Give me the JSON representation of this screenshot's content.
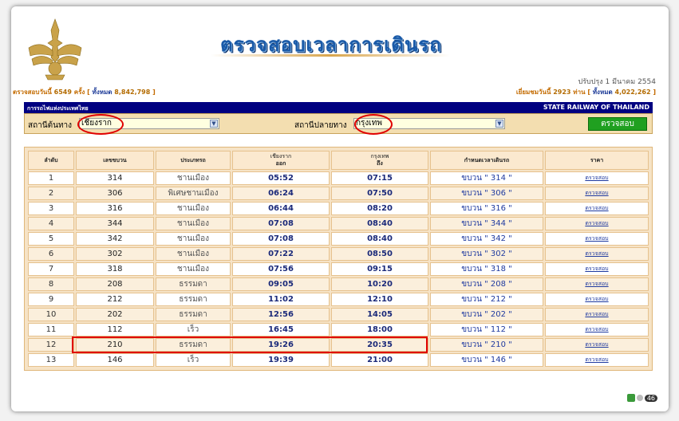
{
  "header": {
    "title": "ตรวจสอบเวลาการเดินรถ",
    "updated": "ปรับปรุง 1 มีนาคม 2554",
    "checks_prefix": "ตรวจสอบวันนี้",
    "checks_today": "6549",
    "checks_unit": "ครั้ง",
    "checks_total_label": "ทั้งหมด",
    "checks_total": "8,842,798",
    "visitors_prefix": "เยี่ยมชมวันนี้",
    "visitors_today": "2923",
    "visitors_unit": "ท่าน",
    "visitors_total_label": "ทั้งหมด",
    "visitors_total": "4,022,262"
  },
  "bar": {
    "org_th": "การรถไฟแห่งประเทศไทย",
    "org_en": "STATE RAILWAY OF THAILAND"
  },
  "search": {
    "origin_label": "สถานีต้นทาง",
    "origin_value": "เชียงราก",
    "destination_label": "สถานีปลายทาง",
    "destination_value": "กรุงเทพ",
    "submit_label": "ตรวจสอบ"
  },
  "table": {
    "headers": {
      "seq": "ลำดับ",
      "train_no": "เลขขบวน",
      "type": "ประเภทรถ",
      "origin_station": "เชียงราก",
      "depart": "ออก",
      "dest_station": "กรุงเทพ",
      "arrive": "ถึง",
      "schedule": "กำหนดเวลาเดินรถ",
      "price": "ราคา"
    },
    "rows": [
      {
        "seq": "1",
        "train_no": "314",
        "type": "ชานเมือง",
        "depart": "05:52",
        "arrive": "07:15",
        "schedule": "ขบวน \" 314 \"",
        "price": "ตรวจสอบ"
      },
      {
        "seq": "2",
        "train_no": "306",
        "type": "พิเศษชานเมือง",
        "depart": "06:24",
        "arrive": "07:50",
        "schedule": "ขบวน \" 306 \"",
        "price": "ตรวจสอบ"
      },
      {
        "seq": "3",
        "train_no": "316",
        "type": "ชานเมือง",
        "depart": "06:44",
        "arrive": "08:20",
        "schedule": "ขบวน \" 316 \"",
        "price": "ตรวจสอบ"
      },
      {
        "seq": "4",
        "train_no": "344",
        "type": "ชานเมือง",
        "depart": "07:08",
        "arrive": "08:40",
        "schedule": "ขบวน \" 344 \"",
        "price": "ตรวจสอบ"
      },
      {
        "seq": "5",
        "train_no": "342",
        "type": "ชานเมือง",
        "depart": "07:08",
        "arrive": "08:40",
        "schedule": "ขบวน \" 342 \"",
        "price": "ตรวจสอบ"
      },
      {
        "seq": "6",
        "train_no": "302",
        "type": "ชานเมือง",
        "depart": "07:22",
        "arrive": "08:50",
        "schedule": "ขบวน \" 302 \"",
        "price": "ตรวจสอบ"
      },
      {
        "seq": "7",
        "train_no": "318",
        "type": "ชานเมือง",
        "depart": "07:56",
        "arrive": "09:15",
        "schedule": "ขบวน \" 318 \"",
        "price": "ตรวจสอบ"
      },
      {
        "seq": "8",
        "train_no": "208",
        "type": "ธรรมดา",
        "depart": "09:05",
        "arrive": "10:20",
        "schedule": "ขบวน \" 208 \"",
        "price": "ตรวจสอบ"
      },
      {
        "seq": "9",
        "train_no": "212",
        "type": "ธรรมดา",
        "depart": "11:02",
        "arrive": "12:10",
        "schedule": "ขบวน \" 212 \"",
        "price": "ตรวจสอบ"
      },
      {
        "seq": "10",
        "train_no": "202",
        "type": "ธรรมดา",
        "depart": "12:56",
        "arrive": "14:05",
        "schedule": "ขบวน \" 202 \"",
        "price": "ตรวจสอบ"
      },
      {
        "seq": "11",
        "train_no": "112",
        "type": "เร็ว",
        "depart": "16:45",
        "arrive": "18:00",
        "schedule": "ขบวน \" 112 \"",
        "price": "ตรวจสอบ"
      },
      {
        "seq": "12",
        "train_no": "210",
        "type": "ธรรมดา",
        "depart": "19:26",
        "arrive": "20:35",
        "schedule": "ขบวน \" 210 \"",
        "price": "ตรวจสอบ"
      },
      {
        "seq": "13",
        "train_no": "146",
        "type": "เร็ว",
        "depart": "19:39",
        "arrive": "21:00",
        "schedule": "ขบวน \" 146 \"",
        "price": "ตรวจสอบ"
      }
    ]
  },
  "footer": {
    "counter_value": "46"
  },
  "colors": {
    "highlight": "#e00000",
    "header_bar": "#000080",
    "accent_orange": "#c36b00"
  }
}
